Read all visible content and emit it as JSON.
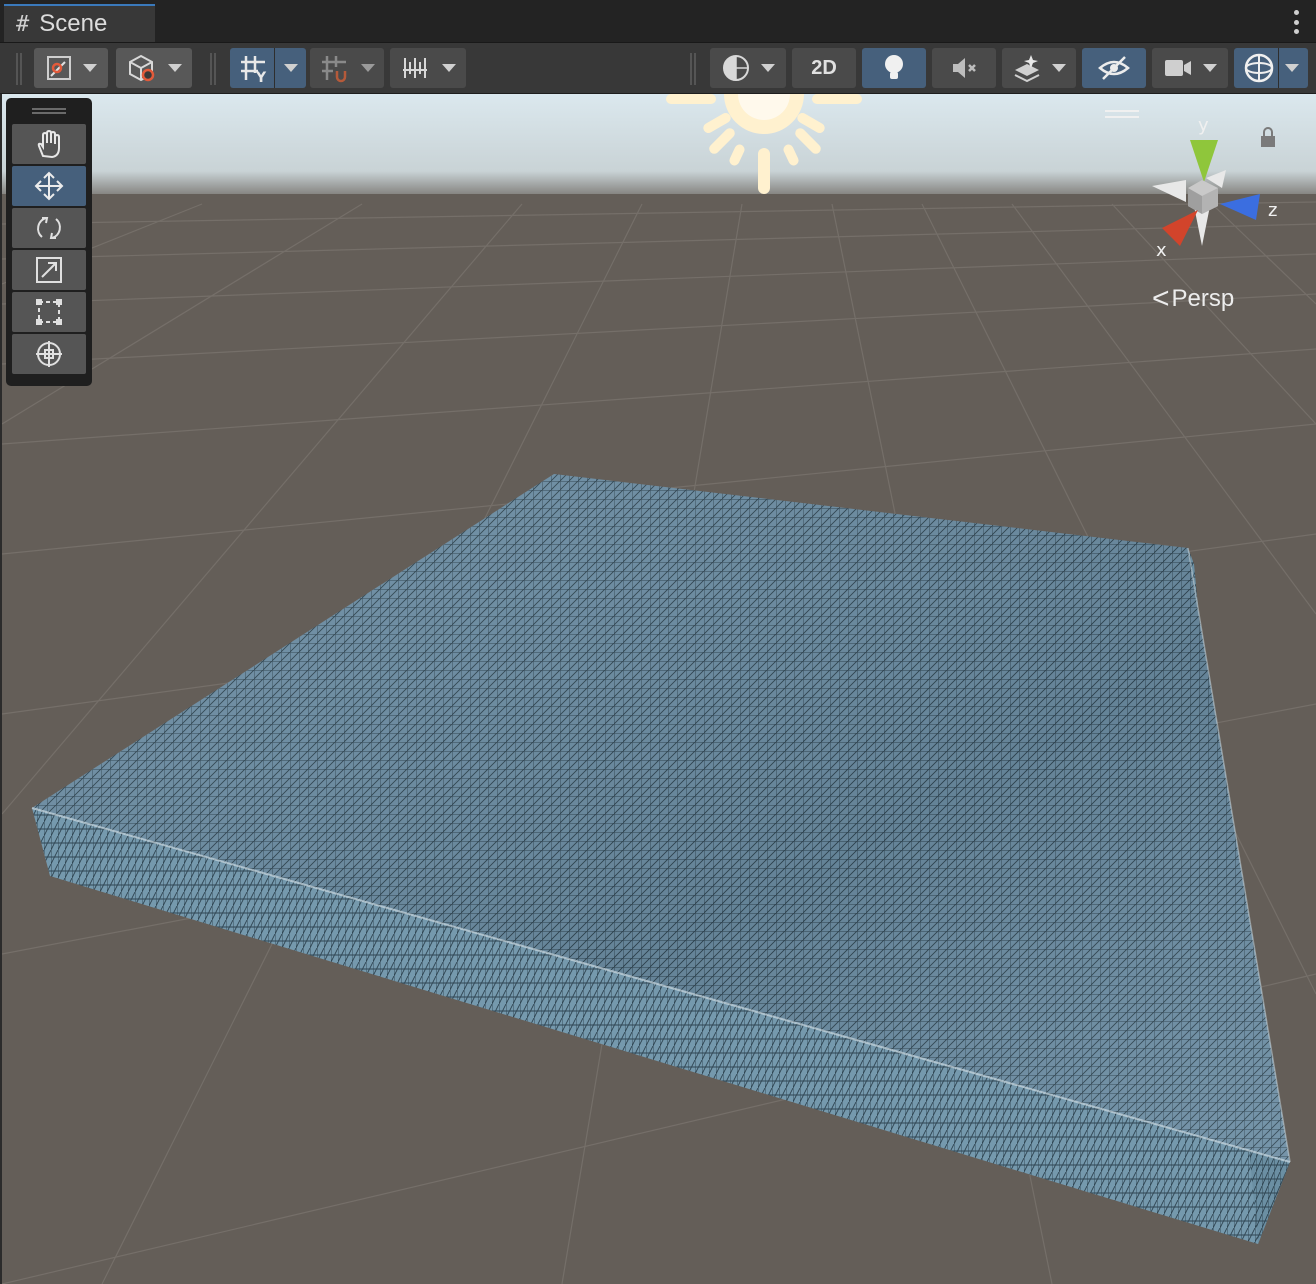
{
  "window": {
    "tab_label": "Scene",
    "tab_icon": "#"
  },
  "toolbar": {
    "buttons": [
      {
        "name": "draw-mode-icon",
        "has_dropdown": true,
        "active": false
      },
      {
        "name": "render-paths-icon",
        "has_dropdown": true,
        "active": false
      },
      {
        "name": "grid-icon",
        "has_dropdown": true,
        "active": true
      },
      {
        "name": "grid-snap-icon",
        "has_dropdown": true,
        "active": false
      },
      {
        "name": "increment-snap-icon",
        "has_dropdown": true,
        "active": false
      },
      {
        "name": "shading-icon",
        "has_dropdown": true,
        "active": false
      },
      {
        "name": "lighting-icon",
        "has_dropdown": false,
        "active": true
      },
      {
        "name": "audio-mute-icon",
        "has_dropdown": false,
        "active": false
      },
      {
        "name": "effects-icon",
        "has_dropdown": true,
        "active": false
      },
      {
        "name": "visibility-icon",
        "has_dropdown": false,
        "active": true
      },
      {
        "name": "camera-icon",
        "has_dropdown": true,
        "active": false
      },
      {
        "name": "gizmos-icon",
        "has_dropdown": true,
        "active": true
      }
    ],
    "mode_2d_label": "2D"
  },
  "tools": [
    {
      "name": "hand-tool-icon",
      "active": false
    },
    {
      "name": "move-tool-icon",
      "active": true
    },
    {
      "name": "rotate-tool-icon",
      "active": false
    },
    {
      "name": "scale-tool-icon",
      "active": false
    },
    {
      "name": "rect-tool-icon",
      "active": false
    },
    {
      "name": "transform-tool-icon",
      "active": false
    }
  ],
  "gizmo": {
    "x_label": "x",
    "y_label": "y",
    "z_label": "z",
    "projection_label": "Persp",
    "colors": {
      "x": "#d2442b",
      "y": "#8fc63b",
      "z": "#3b6ee0"
    }
  },
  "scene": {
    "object_color": "#6f8fa3",
    "ground_color": "#645e58",
    "sky_color": "#dfeaf0",
    "sun_color": "#fff1cf"
  }
}
